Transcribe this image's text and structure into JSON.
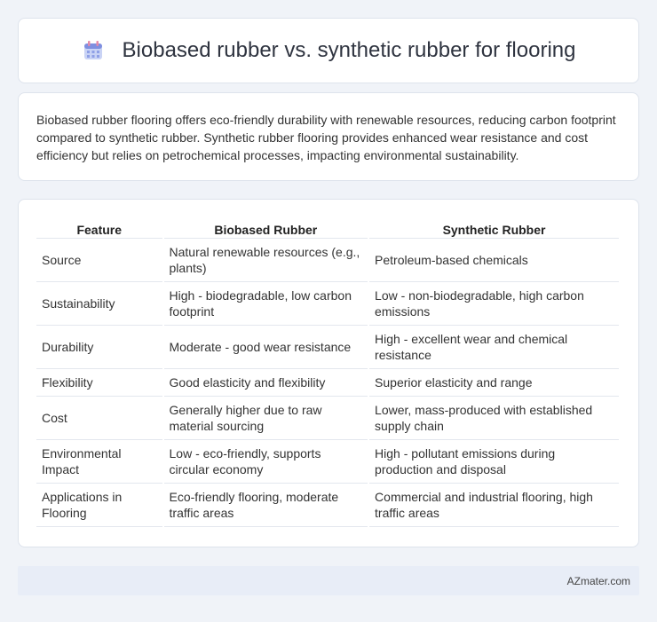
{
  "header": {
    "title": "Biobased rubber vs. synthetic rubber for flooring",
    "icon": "calendar-icon"
  },
  "summary": {
    "text": "Biobased rubber flooring offers eco-friendly durability with renewable resources, reducing carbon footprint compared to synthetic rubber. Synthetic rubber flooring provides enhanced wear resistance and cost efficiency but relies on petrochemical processes, impacting environmental sustainability."
  },
  "table": {
    "headers": [
      "Feature",
      "Biobased Rubber",
      "Synthetic Rubber"
    ],
    "rows": [
      [
        "Source",
        "Natural renewable resources (e.g., plants)",
        "Petroleum-based chemicals"
      ],
      [
        "Sustainability",
        "High - biodegradable, low carbon footprint",
        "Low - non-biodegradable, high carbon emissions"
      ],
      [
        "Durability",
        "Moderate - good wear resistance",
        "High - excellent wear and chemical resistance"
      ],
      [
        "Flexibility",
        "Good elasticity and flexibility",
        "Superior elasticity and range"
      ],
      [
        "Cost",
        "Generally higher due to raw material sourcing",
        "Lower, mass-produced with established supply chain"
      ],
      [
        "Environmental Impact",
        "Low - eco-friendly, supports circular economy",
        "High - pollutant emissions during production and disposal"
      ],
      [
        "Applications in Flooring",
        "Eco-friendly flooring, moderate traffic areas",
        "Commercial and industrial flooring, high traffic areas"
      ]
    ]
  },
  "footer": {
    "brand": "AZmater.com"
  }
}
